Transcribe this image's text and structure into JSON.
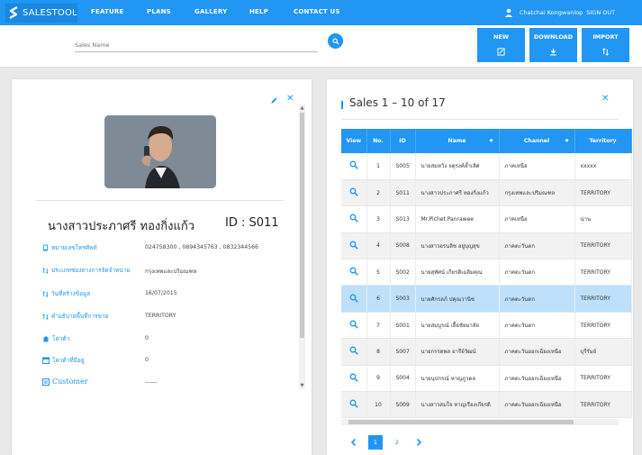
{
  "nav": {
    "brand": "SALESTOOL",
    "items": [
      "FEATURE",
      "PLANS",
      "GALLERY",
      "HELP",
      "CONTACT US"
    ],
    "user_name": "Chatchai Kongwanlop",
    "sign_out": "SIGN OUT"
  },
  "search": {
    "placeholder": "Sales Name"
  },
  "toolbar": {
    "new_label": "NEW",
    "download_label": "DOWNLOAD",
    "import_label": "IMPORT"
  },
  "detail": {
    "name": "นางสาวประภาศรี ทองกิ่งแก้ว",
    "id_text": "ID : S011",
    "fields": [
      {
        "label": "หมายเลขโทรศัพท์",
        "value": "024758300 , 0894345763 , 0832344566",
        "icon": "phone-icon"
      },
      {
        "label": "ประเภทช่องทางการจัดจำหน่าย",
        "value": "กรุงเทพและปริมณฑล",
        "icon": "sort-icon"
      },
      {
        "label": "วันที่สร้างข้อมูล",
        "value": "16/07/2015",
        "icon": "sort-icon"
      },
      {
        "label": "คำอธิบายพื้นที่การขาย",
        "value": "TERRITORY",
        "icon": "sort-icon"
      },
      {
        "label": "โควต้า",
        "value": "0",
        "icon": "home-icon"
      },
      {
        "label": "โควต้าที่มีอยู่",
        "value": "0",
        "icon": "calendar-icon"
      },
      {
        "label": "Customer",
        "value": "------",
        "icon": "list-icon"
      }
    ]
  },
  "sales": {
    "title": "Sales 1 – 10 of 17",
    "columns": [
      "View",
      "No.",
      "ID",
      "Name",
      "Channel",
      "Territory"
    ],
    "rows": [
      {
        "no": "1",
        "id": "S005",
        "name": "นายสมหวัง จตุรงค์ล้ำเลิศ",
        "channel": "ภาคเหนือ",
        "territory": "xxxxx"
      },
      {
        "no": "2",
        "id": "S011",
        "name": "นางสาวประภาศรี ทองกิ่งแก้ว",
        "channel": "กรุงเทพและปริมณฑล",
        "territory": "TERRITORY"
      },
      {
        "no": "3",
        "id": "S013",
        "name": "Mr.Pichet Panrawee",
        "channel": "ภาคเหนือ",
        "territory": "น่าน"
      },
      {
        "no": "4",
        "id": "S008",
        "name": "นางสาวอรนลิช อยู่บุญสุข",
        "channel": "ภาคตะวันตก",
        "territory": "TERRITORY"
      },
      {
        "no": "5",
        "id": "S002",
        "name": "นายสุทัศน์ เกียรติเฉลิมคุณ",
        "channel": "ภาคตะวันตก",
        "territory": "TERRITORY"
      },
      {
        "no": "6",
        "id": "S003",
        "name": "นายศักรลภ์ ปคุณวานิช",
        "channel": "ภาคตะวันตก",
        "territory": "TERRITORY"
      },
      {
        "no": "7",
        "id": "S001",
        "name": "นายสมบูรณ์ เอื้อชัยมาลัย",
        "channel": "ภาคตะวันตก",
        "territory": "TERRITORY"
      },
      {
        "no": "8",
        "id": "S007",
        "name": "นายกรรดพล อารีย์วัฒน์",
        "channel": "ภาคตะวันออกเฉียงเหนือ",
        "territory": "บุรีรัมย์"
      },
      {
        "no": "9",
        "id": "S004",
        "name": "นายนุปกรณ์ หาญภูวดล",
        "channel": "ภาคตะวันออกเฉียงเหนือ",
        "territory": "TERRITORY"
      },
      {
        "no": "10",
        "id": "S009",
        "name": "นางสาวสมใจ หาญเรืองเกียรติ",
        "channel": "ภาคตะวันออกเฉียงเหนือ",
        "territory": "TERRITORY"
      }
    ],
    "selected_row": 6,
    "pages": [
      "1",
      "2"
    ],
    "active_page": "1"
  },
  "colors": {
    "accent": "#2196f3",
    "selected_row": "#bfe0fb"
  }
}
